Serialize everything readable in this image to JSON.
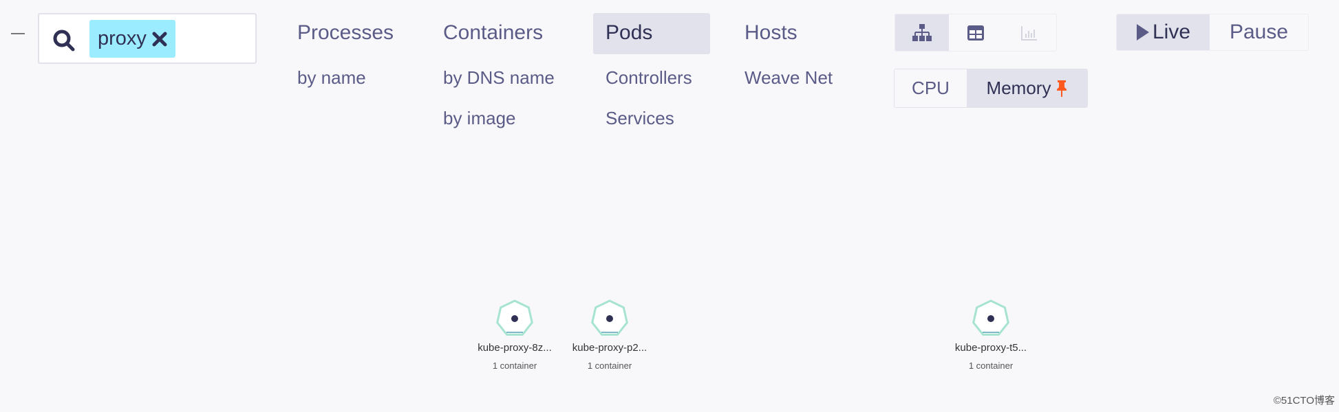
{
  "search": {
    "tag": "proxy",
    "icon": "search-icon",
    "remove_icon": "close-icon"
  },
  "nav": [
    {
      "label": "Processes",
      "subs": [
        "by name"
      ]
    },
    {
      "label": "Containers",
      "subs": [
        "by DNS name",
        "by image"
      ]
    },
    {
      "label": "Pods",
      "subs": [
        "Controllers",
        "Services"
      ],
      "active": true
    },
    {
      "label": "Hosts",
      "subs": [
        "Weave Net"
      ]
    }
  ],
  "view_modes": [
    "topology-icon",
    "table-icon",
    "resources-icon"
  ],
  "metrics": {
    "cpu": "CPU",
    "memory": "Memory",
    "pinned": "memory"
  },
  "playback": {
    "live": "Live",
    "pause": "Pause"
  },
  "nodes": [
    {
      "name": "kube-proxy-8z...",
      "sub": "1 container"
    },
    {
      "name": "kube-proxy-p2...",
      "sub": "1 container"
    },
    {
      "name": "kube-proxy-t5...",
      "sub": "1 container"
    }
  ],
  "colors": {
    "accent": "#9cecff",
    "node_stroke": "#a6e3d0",
    "pin": "#ff5a1f",
    "text": "#5b5b88"
  },
  "watermark": "©51CTO博客"
}
